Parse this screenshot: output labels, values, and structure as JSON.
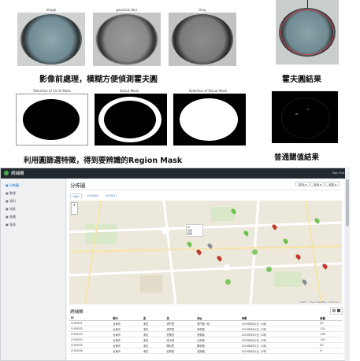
{
  "top_panels": {
    "row1_titles": [
      "Image",
      "gaussian blur",
      "Gray"
    ],
    "row2_titles": [
      "Selection of Circle Mask",
      "Donut Mask",
      "Selection of Donut Mask"
    ],
    "caption1": "影像前處理，模糊方便偵測霍夫圓",
    "caption2": "霍夫圓結果",
    "caption3": "利用圓篩選特徵，得到要辨識的Region Mask",
    "caption4": "普通閾值結果"
  },
  "app": {
    "title": "誘捕機",
    "user_button": "Sign Out",
    "sidebar": [
      {
        "label": "分佈圖",
        "icon": "map-icon",
        "active": true
      },
      {
        "label": "數據",
        "icon": "chart-icon",
        "active": false
      },
      {
        "label": "資料",
        "icon": "table-icon",
        "active": false
      },
      {
        "label": "地區",
        "icon": "pin-icon",
        "active": false
      },
      {
        "label": "物種",
        "icon": "bug-icon",
        "active": false
      },
      {
        "label": "報表",
        "icon": "report-icon",
        "active": false
      }
    ],
    "page_title": "分佈圖",
    "filters": [
      "年份 ▾",
      "月份 ▾",
      "全部 ▾"
    ],
    "tabs": [
      "Map",
      "2019/08",
      "2019/11"
    ],
    "popup": {
      "line1": "ID",
      "line2": "位置",
      "line3": "數量"
    },
    "map_attribution": "Leaflet | © OpenStreetMap contributors",
    "table": {
      "title": "誘捕機",
      "headers": [
        "ID",
        "縣市",
        "區",
        "里",
        "地址",
        "時間",
        "數量"
      ],
      "rows": [
        [
          "CH00001",
          "台南市",
          "東區",
          "東門里",
          "東門路一段",
          "2019年8月1日, 12時",
          "92"
        ],
        [
          "CH00002",
          "台南市",
          "東區",
          "東寧里",
          "東寧路",
          "2019年8月1日, 12時",
          "124"
        ],
        [
          "CH00003",
          "台南市",
          "東區",
          "莊敬里",
          "莊敬路",
          "2019年8月1日, 12時",
          "108"
        ],
        [
          "CH00004",
          "台南市",
          "東區",
          "成大里",
          "大學路",
          "2019年8月1日, 12時",
          "130"
        ],
        [
          "CH00005",
          "台南市",
          "東區",
          "勝利里",
          "勝利路",
          "2019年8月1日, 12時",
          "80"
        ],
        [
          "CH00006",
          "台南市",
          "東區",
          "前鋒里",
          "前鋒路",
          "2019年8月1日, 12時",
          "6"
        ]
      ]
    }
  },
  "colors": {
    "topbar": "#222a30",
    "accent": "#1b6fd0",
    "marker_green": "#6cc04a",
    "marker_red": "#c0392b",
    "marker_gray": "#8a8f96"
  }
}
